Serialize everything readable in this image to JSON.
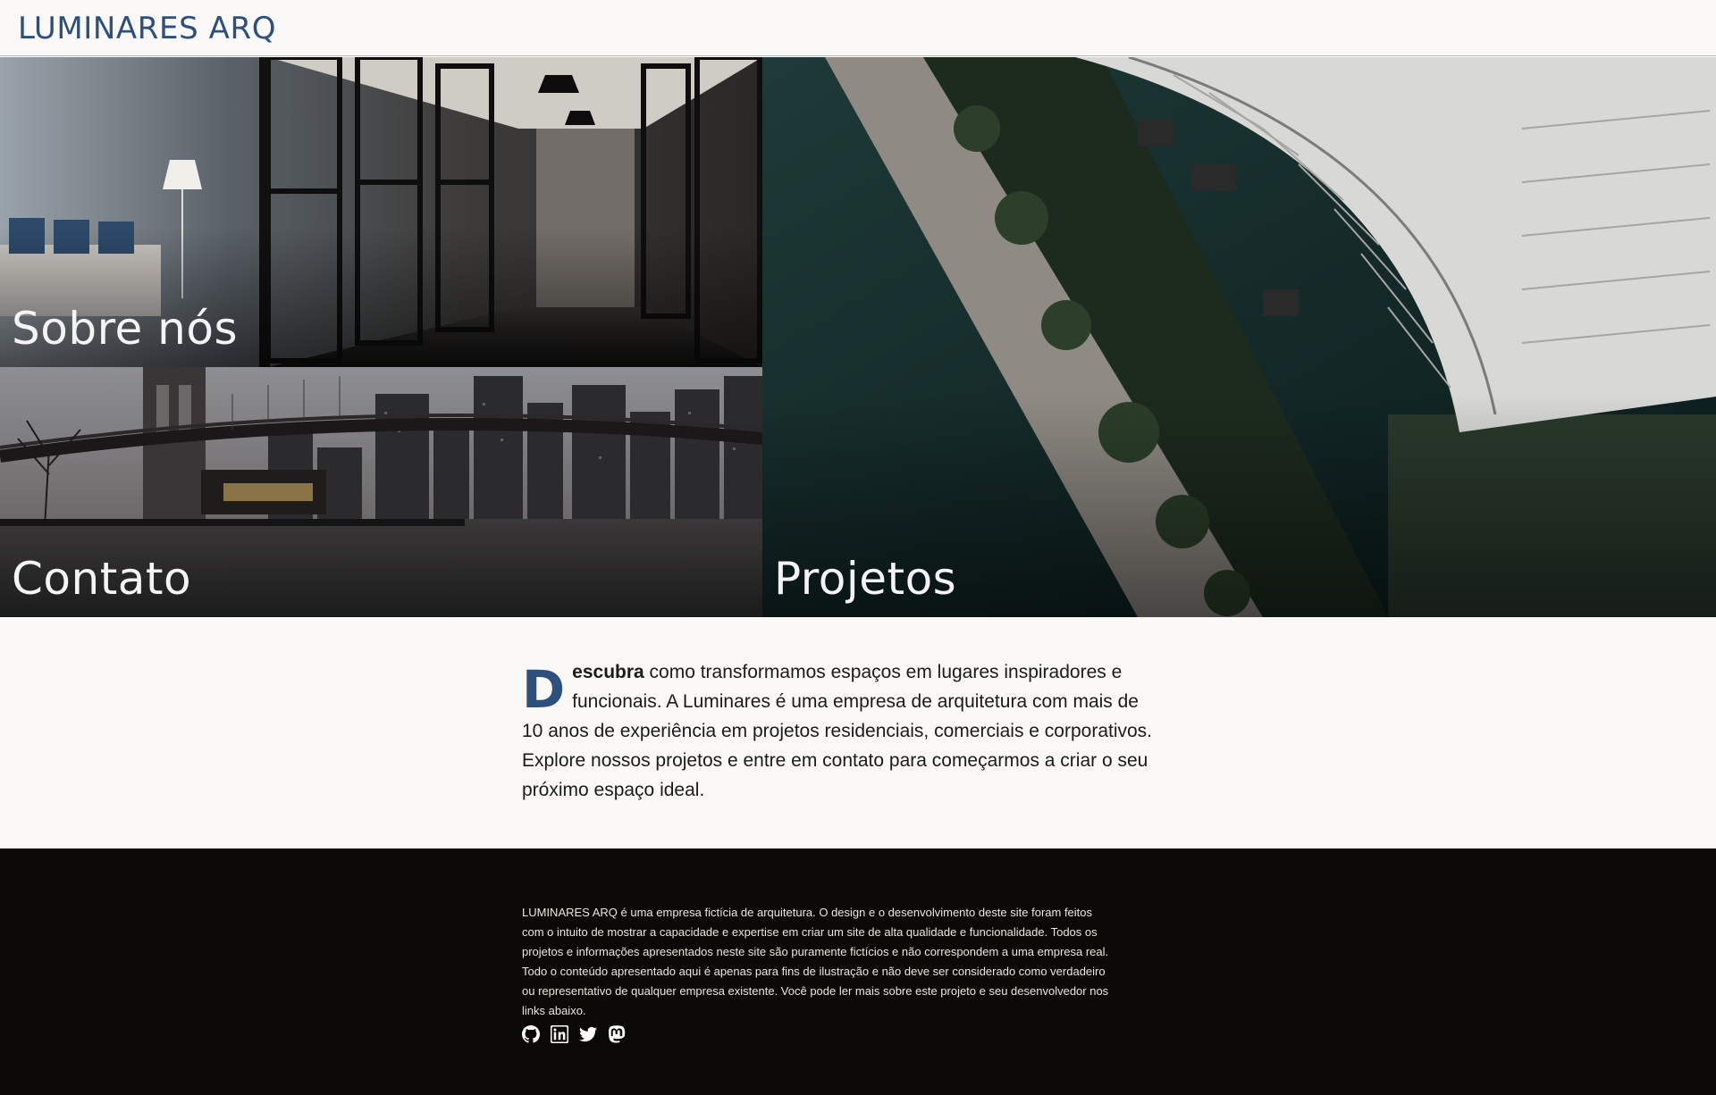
{
  "header": {
    "logo": "LUMINARES ARQ"
  },
  "tiles": {
    "about": "Sobre nós",
    "contact": "Contato",
    "projects": "Projetos"
  },
  "intro": {
    "dropcap": "D",
    "bold": "escubra",
    "text": " como transformamos espaços em lugares inspiradores e funcionais. A Luminares é uma empresa de arquitetura com mais de 10 anos de experiência em projetos residenciais, comerciais e corporativos. Explore nossos projetos e entre em contato para começarmos a criar o seu próximo espaço ideal."
  },
  "footer": {
    "disclaimer": "LUMINARES ARQ é uma empresa fictícia de arquitetura. O design e o desenvolvimento deste site foram feitos com o intuito de mostrar a capacidade e expertise em criar um site de alta qualidade e funcionalidade. Todos os projetos e informações apresentados neste site são puramente fictícios e não correspondem a uma empresa real. Todo o conteúdo apresentado aqui é apenas para fins de ilustração e não deve ser considerado como verdadeiro ou representativo de qualquer empresa existente. Você pode ler mais sobre este projeto e seu desenvolvedor nos links abaixo.",
    "socials": [
      "github-icon",
      "linkedin-icon",
      "twitter-icon",
      "mastodon-icon"
    ]
  },
  "colors": {
    "brand": "#2f4f7c",
    "footer_bg": "#0a0906",
    "page_bg": "#faf9f7"
  }
}
